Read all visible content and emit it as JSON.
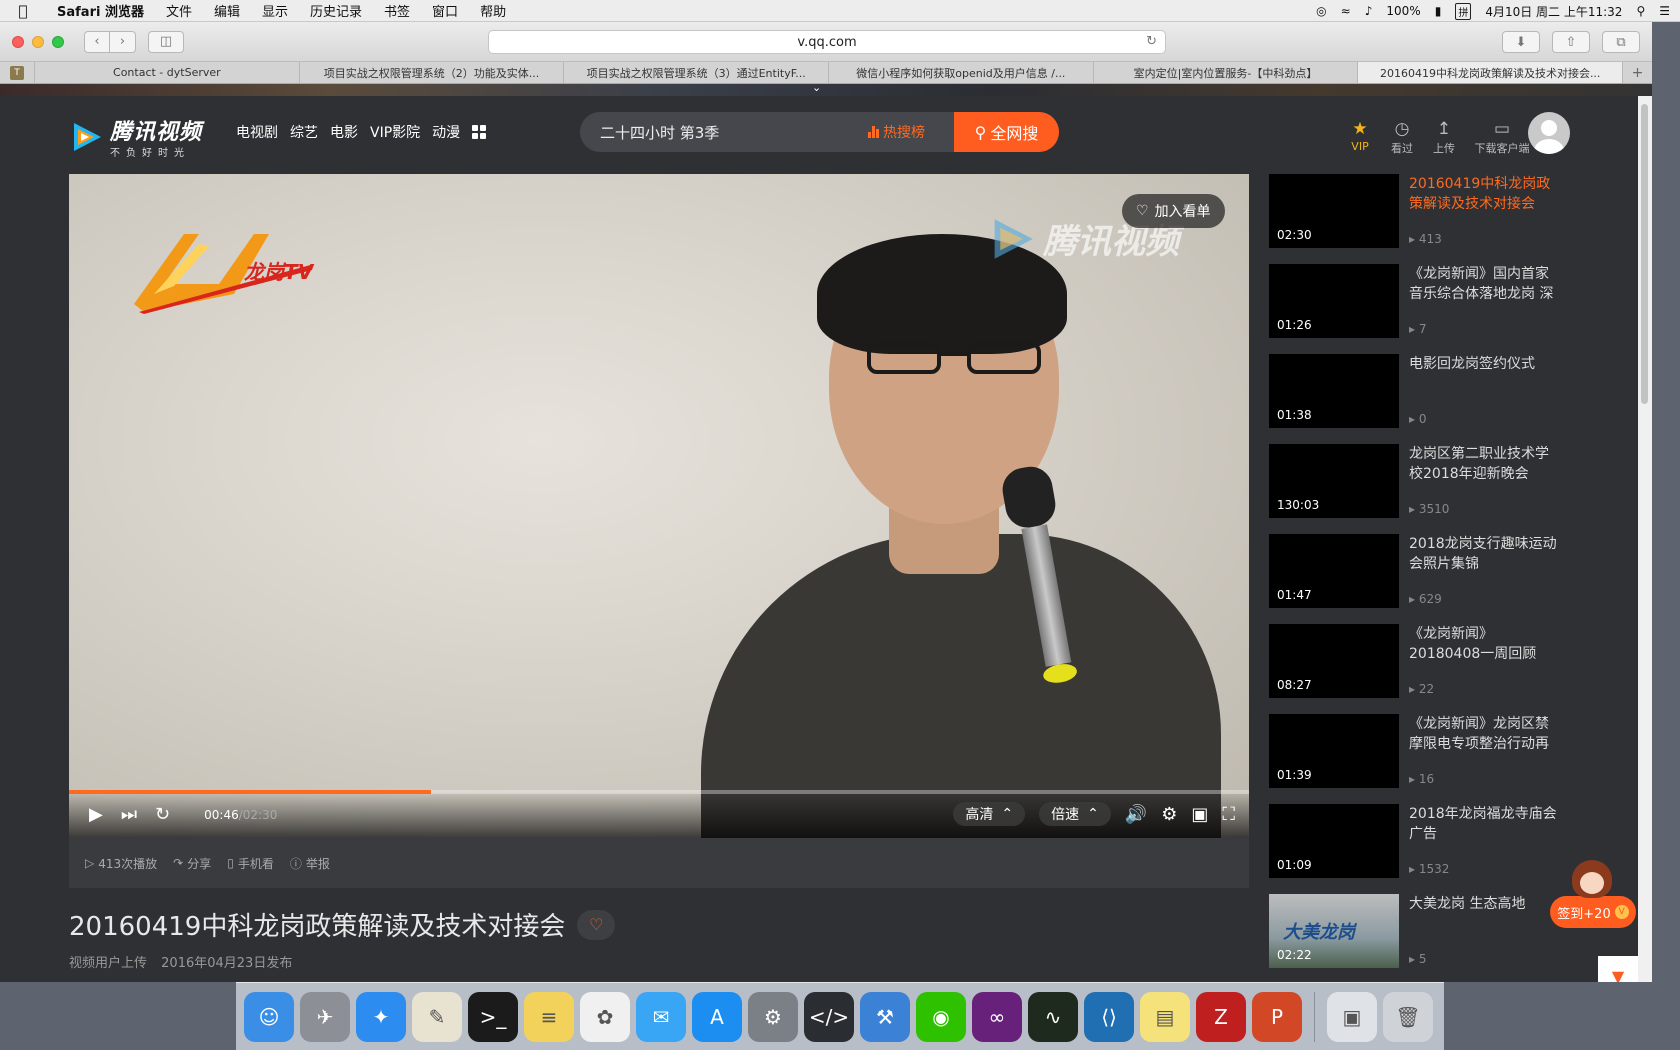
{
  "menubar": {
    "app": "Safari 浏览器",
    "items": [
      "文件",
      "编辑",
      "显示",
      "历史记录",
      "书签",
      "窗口",
      "帮助"
    ],
    "battery": "100%",
    "input_method": "拼",
    "datetime": "4月10日 周二 上午11:32"
  },
  "browser": {
    "url": "v.qq.com",
    "tab_favicon": "T",
    "tabs": [
      {
        "label": "Contact - dytServer"
      },
      {
        "label": "项目实战之权限管理系统（2）功能及实体..."
      },
      {
        "label": "项目实战之权限管理系统（3）通过EntityF..."
      },
      {
        "label": "微信小程序如何获取openid及用户信息 /..."
      },
      {
        "label": "室内定位|室内位置服务-【中科劲点】"
      },
      {
        "label": "20160419中科龙岗政策解读及技术对接会..."
      }
    ]
  },
  "header": {
    "logo_name": "腾讯视频",
    "logo_slogan": "不负好时光",
    "nav": [
      "电视剧",
      "综艺",
      "电影",
      "VIP影院",
      "动漫"
    ],
    "search_value": "二十四小时 第3季",
    "hot_label": "热搜榜",
    "search_button": "全网搜",
    "icons": [
      {
        "icon": "vip-crown-icon",
        "label": "VIP"
      },
      {
        "icon": "history-clock-icon",
        "label": "看过"
      },
      {
        "icon": "upload-icon",
        "label": "上传"
      },
      {
        "icon": "monitor-icon",
        "label": "下载客户端"
      }
    ]
  },
  "player": {
    "station_logo": "龙岗TV",
    "watermark": "腾讯视频",
    "add_watchlist": "加入看单",
    "current_time": "00:46",
    "duration": "/02:30",
    "progress_fraction": 0.307,
    "quality": "高清",
    "speed": "倍速"
  },
  "meta": {
    "plays": "413次播放",
    "share": "分享",
    "mobile": "手机看",
    "report": "举报"
  },
  "video": {
    "title": "20160419中科龙岗政策解读及技术对接会",
    "uploader": "视频用户上传",
    "published": "2016年04月23日发布"
  },
  "playlist": [
    {
      "title": "20160419中科龙岗政策解读及技术对接会",
      "duration": "02:30",
      "count": "413",
      "active": true
    },
    {
      "title": "《龙岗新闻》国内首家音乐综合体落地龙岗 深",
      "duration": "01:26",
      "count": "7"
    },
    {
      "title": "电影回龙岗签约仪式",
      "duration": "01:38",
      "count": "0"
    },
    {
      "title": "龙岗区第二职业技术学校2018年迎新晚会",
      "duration": "130:03",
      "count": "3510"
    },
    {
      "title": "2018龙岗支行趣味运动会照片集锦",
      "duration": "01:47",
      "count": "629"
    },
    {
      "title": "《龙岗新闻》20180408一周回顾",
      "duration": "08:27",
      "count": "22"
    },
    {
      "title": "《龙岗新闻》龙岗区禁摩限电专项整治行动再",
      "duration": "01:39",
      "count": "16"
    },
    {
      "title": "2018年龙岗福龙寺庙会广告",
      "duration": "01:09",
      "count": "1532"
    },
    {
      "title": "大美龙岗 生态高地",
      "duration": "02:22",
      "count": "5",
      "thumb_text": "大美龙岗"
    }
  ],
  "sign_in": "签到+20",
  "dock": [
    {
      "name": "finder-icon",
      "color": "#3a8ee6"
    },
    {
      "name": "launchpad-icon",
      "color": "#8c8f96"
    },
    {
      "name": "safari-icon",
      "color": "#2d8cf0"
    },
    {
      "name": "textedit-icon",
      "color": "#e8e2d0"
    },
    {
      "name": "terminal-icon",
      "color": "#1b1b1b"
    },
    {
      "name": "notes-icon",
      "color": "#f3d25b"
    },
    {
      "name": "photos-icon",
      "color": "#f0f0f0"
    },
    {
      "name": "messages-icon",
      "color": "#38a5f5"
    },
    {
      "name": "app-store-icon",
      "color": "#1c8ef2"
    },
    {
      "name": "system-preferences-icon",
      "color": "#7b7f86"
    },
    {
      "name": "code-editor-icon",
      "color": "#2a2e33"
    },
    {
      "name": "xcode-icon",
      "color": "#3b82d6"
    },
    {
      "name": "wechat-icon",
      "color": "#2dc100"
    },
    {
      "name": "visual-studio-icon",
      "color": "#68217a"
    },
    {
      "name": "activity-monitor-icon",
      "color": "#1e2a1e"
    },
    {
      "name": "vscode-icon",
      "color": "#1f6fb2"
    },
    {
      "name": "stickies-icon",
      "color": "#f6e27a"
    },
    {
      "name": "filezilla-icon",
      "color": "#bf1f1f"
    },
    {
      "name": "powerpoint-icon",
      "color": "#d24726"
    },
    {
      "name": "preview-icon",
      "color": "#dfe3e8"
    },
    {
      "name": "trash-icon",
      "color": "#cfd3d8"
    }
  ]
}
